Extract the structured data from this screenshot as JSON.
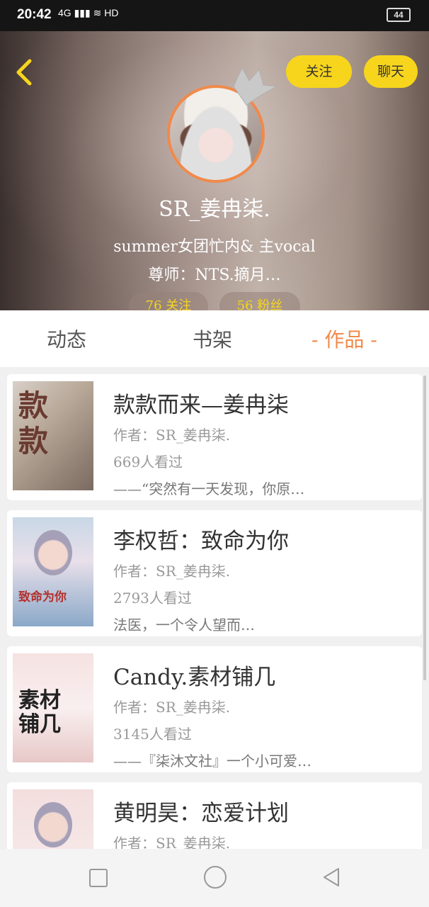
{
  "status_bar": {
    "time": "20:42",
    "signal": "4G",
    "network": "HD",
    "battery": "44"
  },
  "profile": {
    "follow_label": "关注",
    "chat_label": "聊天",
    "username": "SR_姜冉柒.",
    "bio_line1": "summer女团忙内& 主vocal",
    "bio_line2": "尊师：NTS.摘月…",
    "stat_following": "76 关注",
    "stat_followers": "56 粉丝"
  },
  "tabs": [
    {
      "label": "动态"
    },
    {
      "label": "书架"
    },
    {
      "label": "- 作品 -"
    }
  ],
  "works": [
    {
      "title": "款款而来—姜冉柒",
      "author": "作者：SR_姜冉柒.",
      "views": "669人看过",
      "desc": "——“突然有一天发现，你原…",
      "cover_text": "款\n款"
    },
    {
      "title": "李权哲：致命为你",
      "author": "作者：SR_姜冉柒.",
      "views": "2793人看过",
      "desc": "法医，一个令人望而…",
      "cover_text": "致命为你"
    },
    {
      "title": "Candy.素材铺几",
      "author": "作者：SR_姜冉柒.",
      "views": "3145人看过",
      "desc": "——『柒沐文社』一个小可爱…",
      "cover_text": "素材\n铺几"
    },
    {
      "title": "黄明昊：恋爱计划",
      "author": "作者：SR_姜冉柒.",
      "views": "",
      "desc": "",
      "cover_text": ""
    }
  ],
  "colors": {
    "accent_yellow": "#f7d51c",
    "accent_orange": "#f08a4b"
  }
}
